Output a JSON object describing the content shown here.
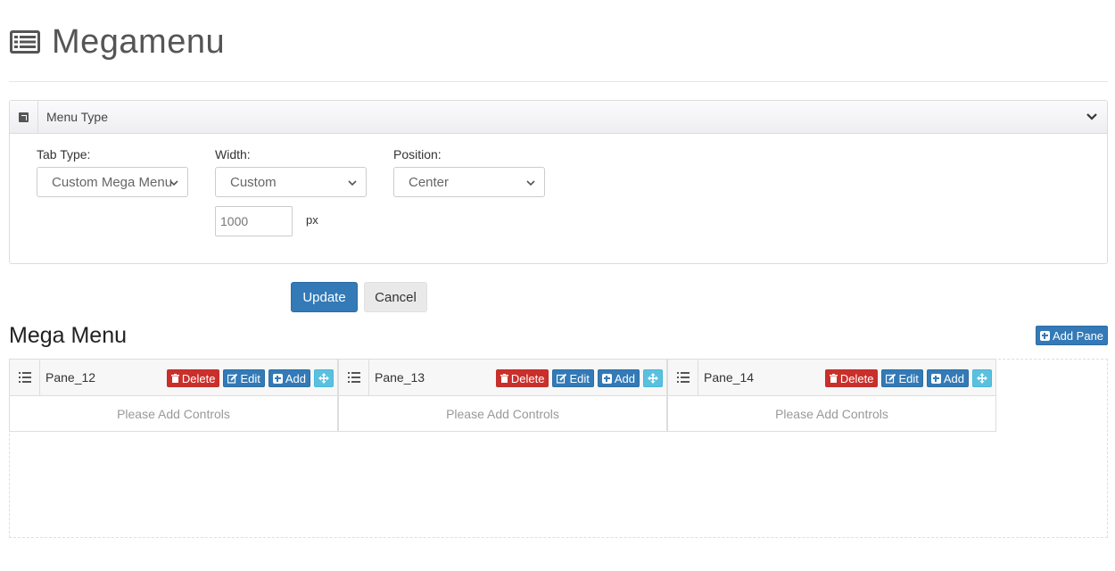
{
  "page": {
    "title": "Megamenu",
    "icon": "list-alt-icon"
  },
  "menu_type_panel": {
    "title": "Menu Type",
    "collapse_icon": "chevron-down-icon",
    "fields": {
      "tab_type": {
        "label": "Tab Type:",
        "value": "Custom Mega Menu"
      },
      "width": {
        "label": "Width:",
        "value": "Custom",
        "custom_value": "1000",
        "unit": "px"
      },
      "position": {
        "label": "Position:",
        "value": "Center"
      }
    }
  },
  "actions": {
    "update_label": "Update",
    "cancel_label": "Cancel"
  },
  "mega_menu": {
    "title": "Mega Menu",
    "add_pane_label": "Add Pane",
    "delete_label": "Delete",
    "edit_label": "Edit",
    "add_label": "Add",
    "empty_text": "Please Add Controls",
    "panes": [
      {
        "name": "Pane_12"
      },
      {
        "name": "Pane_13"
      },
      {
        "name": "Pane_14"
      }
    ]
  },
  "colors": {
    "primary": "#337ab7",
    "danger": "#c9302c",
    "info": "#5bc0de"
  }
}
